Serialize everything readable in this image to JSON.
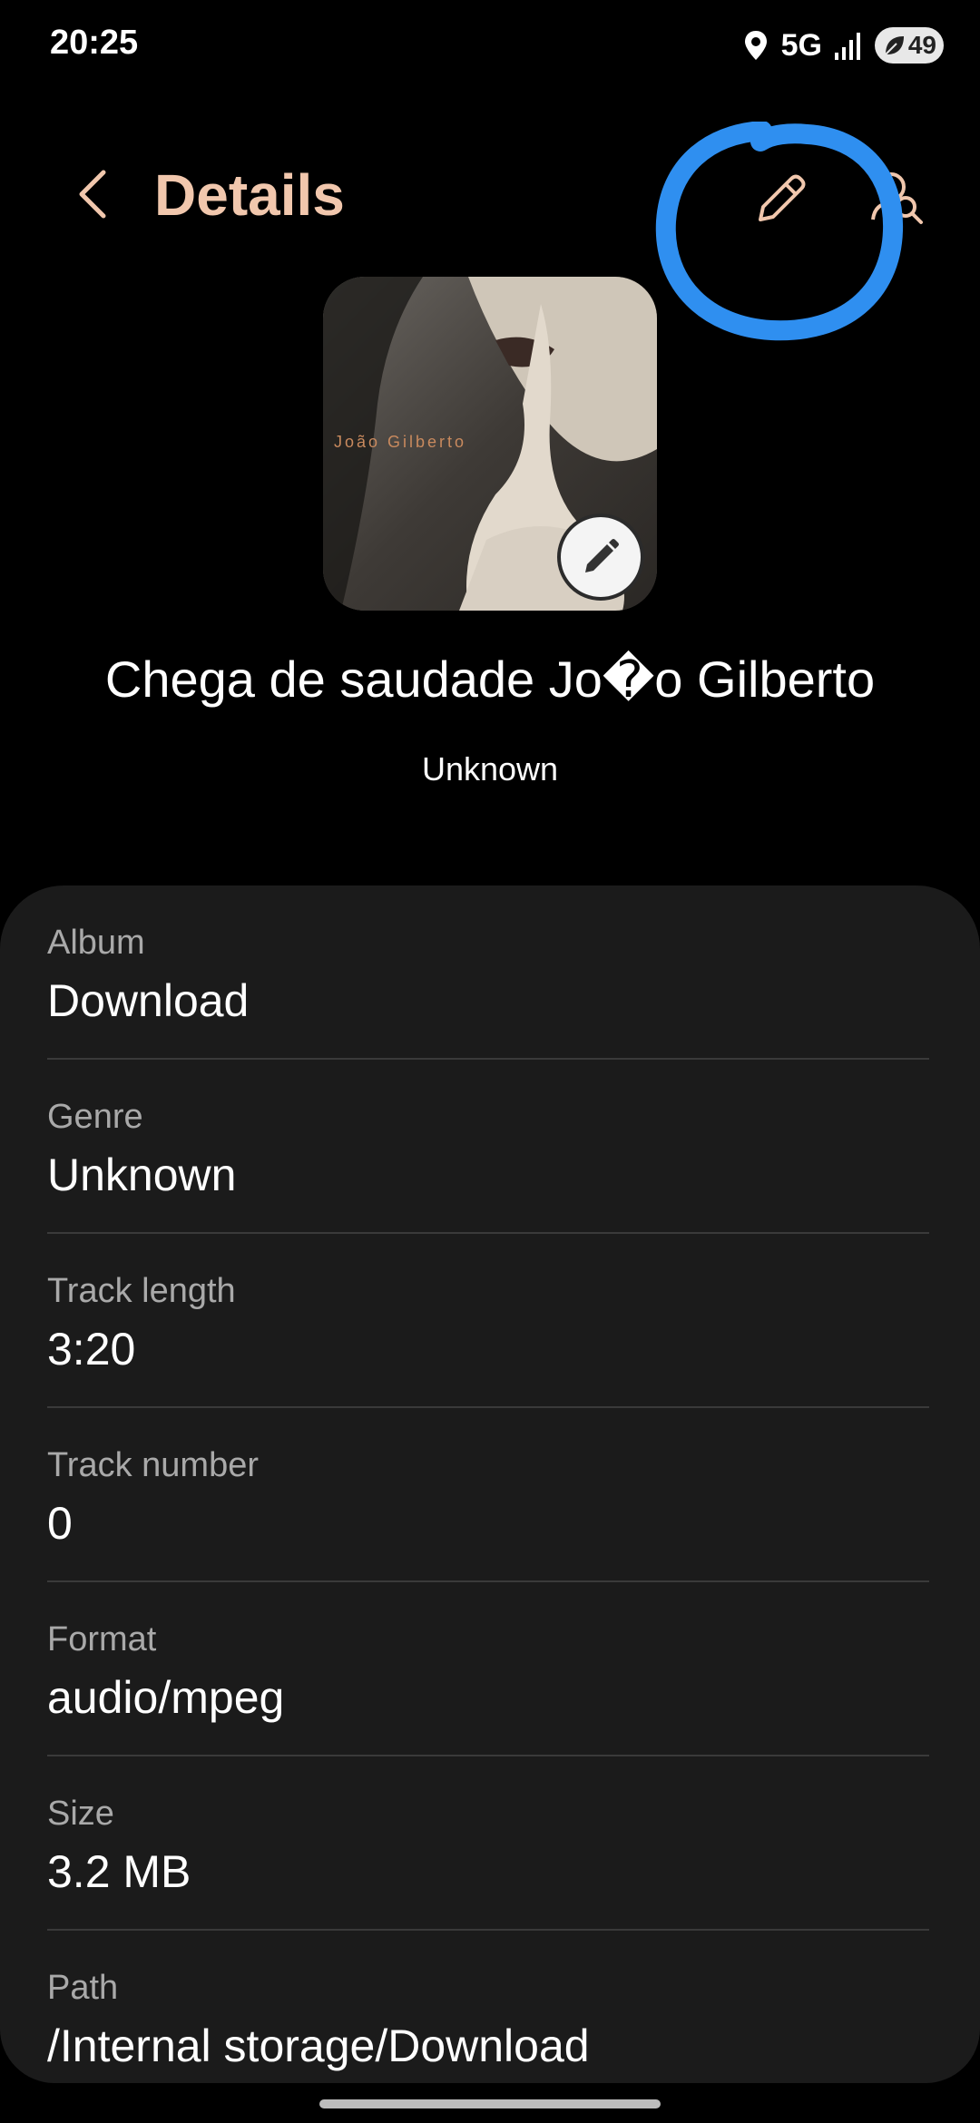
{
  "status_bar": {
    "time": "20:25",
    "network": "5G",
    "battery": "49",
    "icons": [
      "location-icon",
      "signal-icon",
      "battery-saver-leaf-icon"
    ]
  },
  "header": {
    "title": "Details",
    "icons": [
      "back-arrow-icon",
      "pencil-icon",
      "search-user-icon"
    ],
    "accent_color": "#f1c7ad"
  },
  "album_art": {
    "caption": "João Gilberto",
    "edit_icon": "pencil-filled-icon"
  },
  "song": {
    "title": "Chega de saudade Jo�o Gilberto",
    "artist": "Unknown"
  },
  "details": [
    {
      "label": "Album",
      "value": "Download"
    },
    {
      "label": "Genre",
      "value": "Unknown"
    },
    {
      "label": "Track length",
      "value": "3:20"
    },
    {
      "label": "Track number",
      "value": "0"
    },
    {
      "label": "Format",
      "value": "audio/mpeg"
    },
    {
      "label": "Size",
      "value": "3.2 MB"
    },
    {
      "label": "Path",
      "value": "/Internal storage/Download"
    }
  ],
  "annotation_color": "#2f8ff0"
}
